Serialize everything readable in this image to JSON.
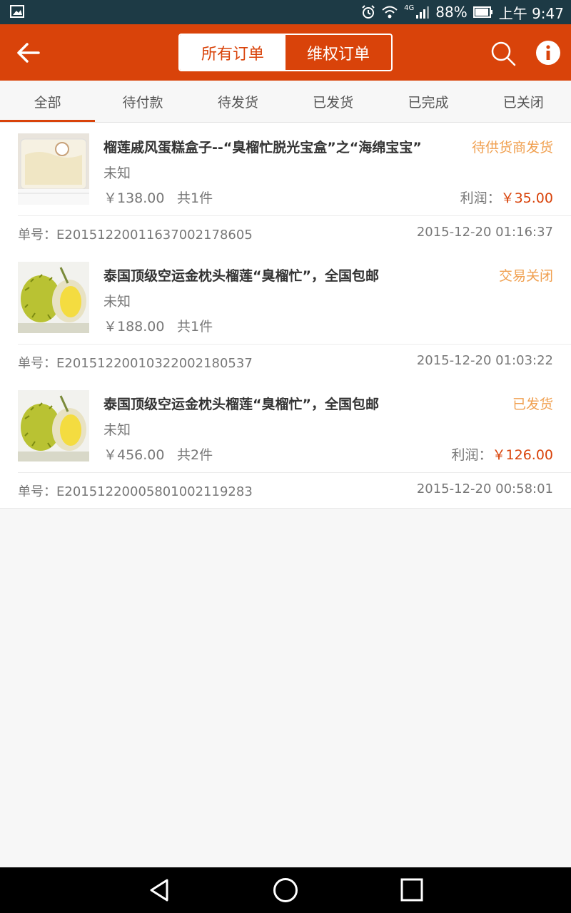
{
  "status_bar": {
    "signal_label": "4G",
    "battery": "88%",
    "time": "上午 9:47"
  },
  "segments": {
    "all_orders": "所有订单",
    "rights_orders": "维权订单"
  },
  "tabs": [
    "全部",
    "待付款",
    "待发货",
    "已发货",
    "已完成",
    "已关闭"
  ],
  "orders": [
    {
      "title": "榴莲戚风蛋糕盒子--“臭榴忙脱光宝盒”之“海绵宝宝”",
      "status": "待供货商发货",
      "spec": "未知",
      "price": "￥138.00",
      "qty": "共1件",
      "profit_label": "利润：",
      "profit_value": "￥35.00",
      "order_no": "单号：E20151220011637002178605",
      "date": "2015-12-20 01:16:37"
    },
    {
      "title": "泰国顶级空运金枕头榴莲“臭榴忙”，全国包邮",
      "status": "交易关闭",
      "spec": "未知",
      "price": "￥188.00",
      "qty": "共1件",
      "order_no": "单号：E20151220010322002180537",
      "date": "2015-12-20 01:03:22"
    },
    {
      "title": "泰国顶级空运金枕头榴莲“臭榴忙”，全国包邮",
      "status": "已发货",
      "spec": "未知",
      "price": "￥456.00",
      "qty": "共2件",
      "profit_label": "利润：",
      "profit_value": "￥126.00",
      "order_no": "单号：E20151220005801002119283",
      "date": "2015-12-20 00:58:01"
    }
  ],
  "colors": {
    "accent": "#d9430a",
    "status_orange": "#f0a050",
    "status_bar": "#1d3a45"
  },
  "icons": [
    "gallery-icon",
    "alarm-icon",
    "wifi-icon",
    "signal-icon",
    "battery-icon",
    "back-arrow-icon",
    "search-icon",
    "info-icon",
    "cake-thumbnail",
    "durian-thumbnail",
    "nav-back-icon",
    "nav-home-icon",
    "nav-recents-icon"
  ]
}
